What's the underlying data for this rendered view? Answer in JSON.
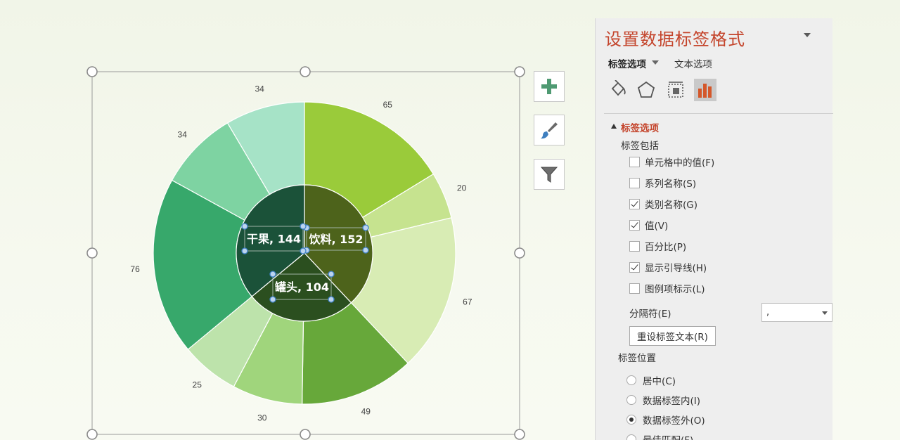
{
  "chart_data": {
    "type": "pie",
    "inner_ring": {
      "categories": [
        "饮料",
        "罐头",
        "干果"
      ],
      "values": [
        152,
        104,
        144
      ],
      "labels": [
        "饮料, 152",
        "罐头, 104",
        "干果, 144"
      ],
      "colors": [
        "#4d631b",
        "#2b4f1f",
        "#1b5239"
      ]
    },
    "outer_ring": {
      "values": [
        65,
        20,
        67,
        49,
        30,
        25,
        76,
        34,
        34
      ],
      "labels": [
        "65",
        "20",
        "67",
        "49",
        "30",
        "25",
        "76",
        "34",
        "34"
      ],
      "colors": [
        "#9acb3a",
        "#c6e38f",
        "#d8ecb4",
        "#67a83a",
        "#a0d57c",
        "#bde3ab",
        "#37a86b",
        "#7ed3a2",
        "#a6e3c7"
      ]
    }
  },
  "pane": {
    "title": "设置数据标签格式",
    "tabs": {
      "label_options": "标签选项",
      "text_options": "文本选项"
    },
    "icons": [
      "fill-bucket-icon",
      "pentagon-icon",
      "size-layout-icon",
      "bar-chart-icon"
    ],
    "section_title": "标签选项",
    "include_heading": "标签包括",
    "checkboxes": [
      {
        "label": "单元格中的值(F)",
        "checked": false
      },
      {
        "label": "系列名称(S)",
        "checked": false
      },
      {
        "label": "类别名称(G)",
        "checked": true
      },
      {
        "label": "值(V)",
        "checked": true
      },
      {
        "label": "百分比(P)",
        "checked": false
      },
      {
        "label": "显示引导线(H)",
        "checked": true
      },
      {
        "label": "图例项标示(L)",
        "checked": false
      }
    ],
    "separator_label": "分隔符(E)",
    "separator_value": ",",
    "reset_button": "重设标签文本(R)",
    "position_heading": "标签位置",
    "radios": [
      {
        "label": "居中(C)",
        "checked": false
      },
      {
        "label": "数据标签内(I)",
        "checked": false
      },
      {
        "label": "数据标签外(O)",
        "checked": true
      },
      {
        "label": "最佳匹配(F)",
        "checked": false
      }
    ]
  },
  "side_buttons": [
    "add-element-icon",
    "brush-icon",
    "filter-icon"
  ]
}
